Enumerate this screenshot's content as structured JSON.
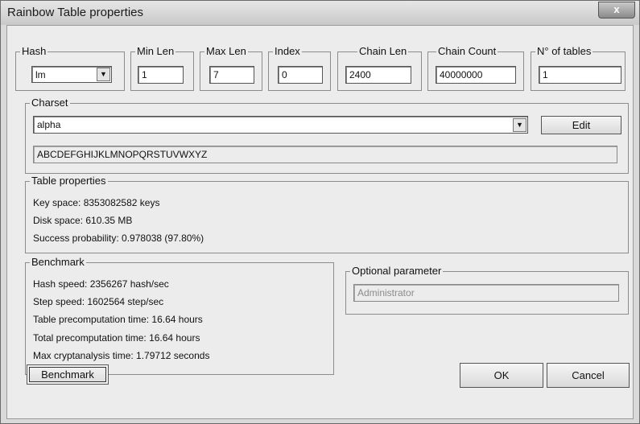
{
  "window": {
    "title": "Rainbow Table properties",
    "close_label": "x"
  },
  "params": {
    "hash": {
      "label": "Hash",
      "value": "lm"
    },
    "min_len": {
      "label": "Min Len",
      "value": "1"
    },
    "max_len": {
      "label": "Max Len",
      "value": "7"
    },
    "index": {
      "label": "Index",
      "value": "0"
    },
    "chain_len": {
      "label": "Chain Len",
      "value": "2400"
    },
    "chain_count": {
      "label": "Chain Count",
      "value": "40000000"
    },
    "num_tables": {
      "label": "N° of tables",
      "value": "1"
    }
  },
  "charset": {
    "label": "Charset",
    "selected": "alpha",
    "edit_label": "Edit",
    "characters": "ABCDEFGHIJKLMNOPQRSTUVWXYZ"
  },
  "table_props": {
    "label": "Table properties",
    "key_space": "Key space: 8353082582 keys",
    "disk_space": "Disk space: 610.35 MB",
    "success": "Success probability: 0.978038 (97.80%)"
  },
  "benchmark": {
    "label": "Benchmark",
    "hash_speed": "Hash speed: 2356267 hash/sec",
    "step_speed": "Step speed: 1602564 step/sec",
    "table_time": "Table precomputation time: 16.64 hours",
    "total_time": "Total precomputation time: 16.64 hours",
    "max_crypt": "Max cryptanalysis time: 1.79712 seconds"
  },
  "optional": {
    "label": "Optional parameter",
    "value": "Administrator"
  },
  "buttons": {
    "benchmark": "Benchmark",
    "ok": "OK",
    "cancel": "Cancel"
  },
  "icons": {
    "dropdown": "chevron-down-icon",
    "close": "close-icon"
  }
}
